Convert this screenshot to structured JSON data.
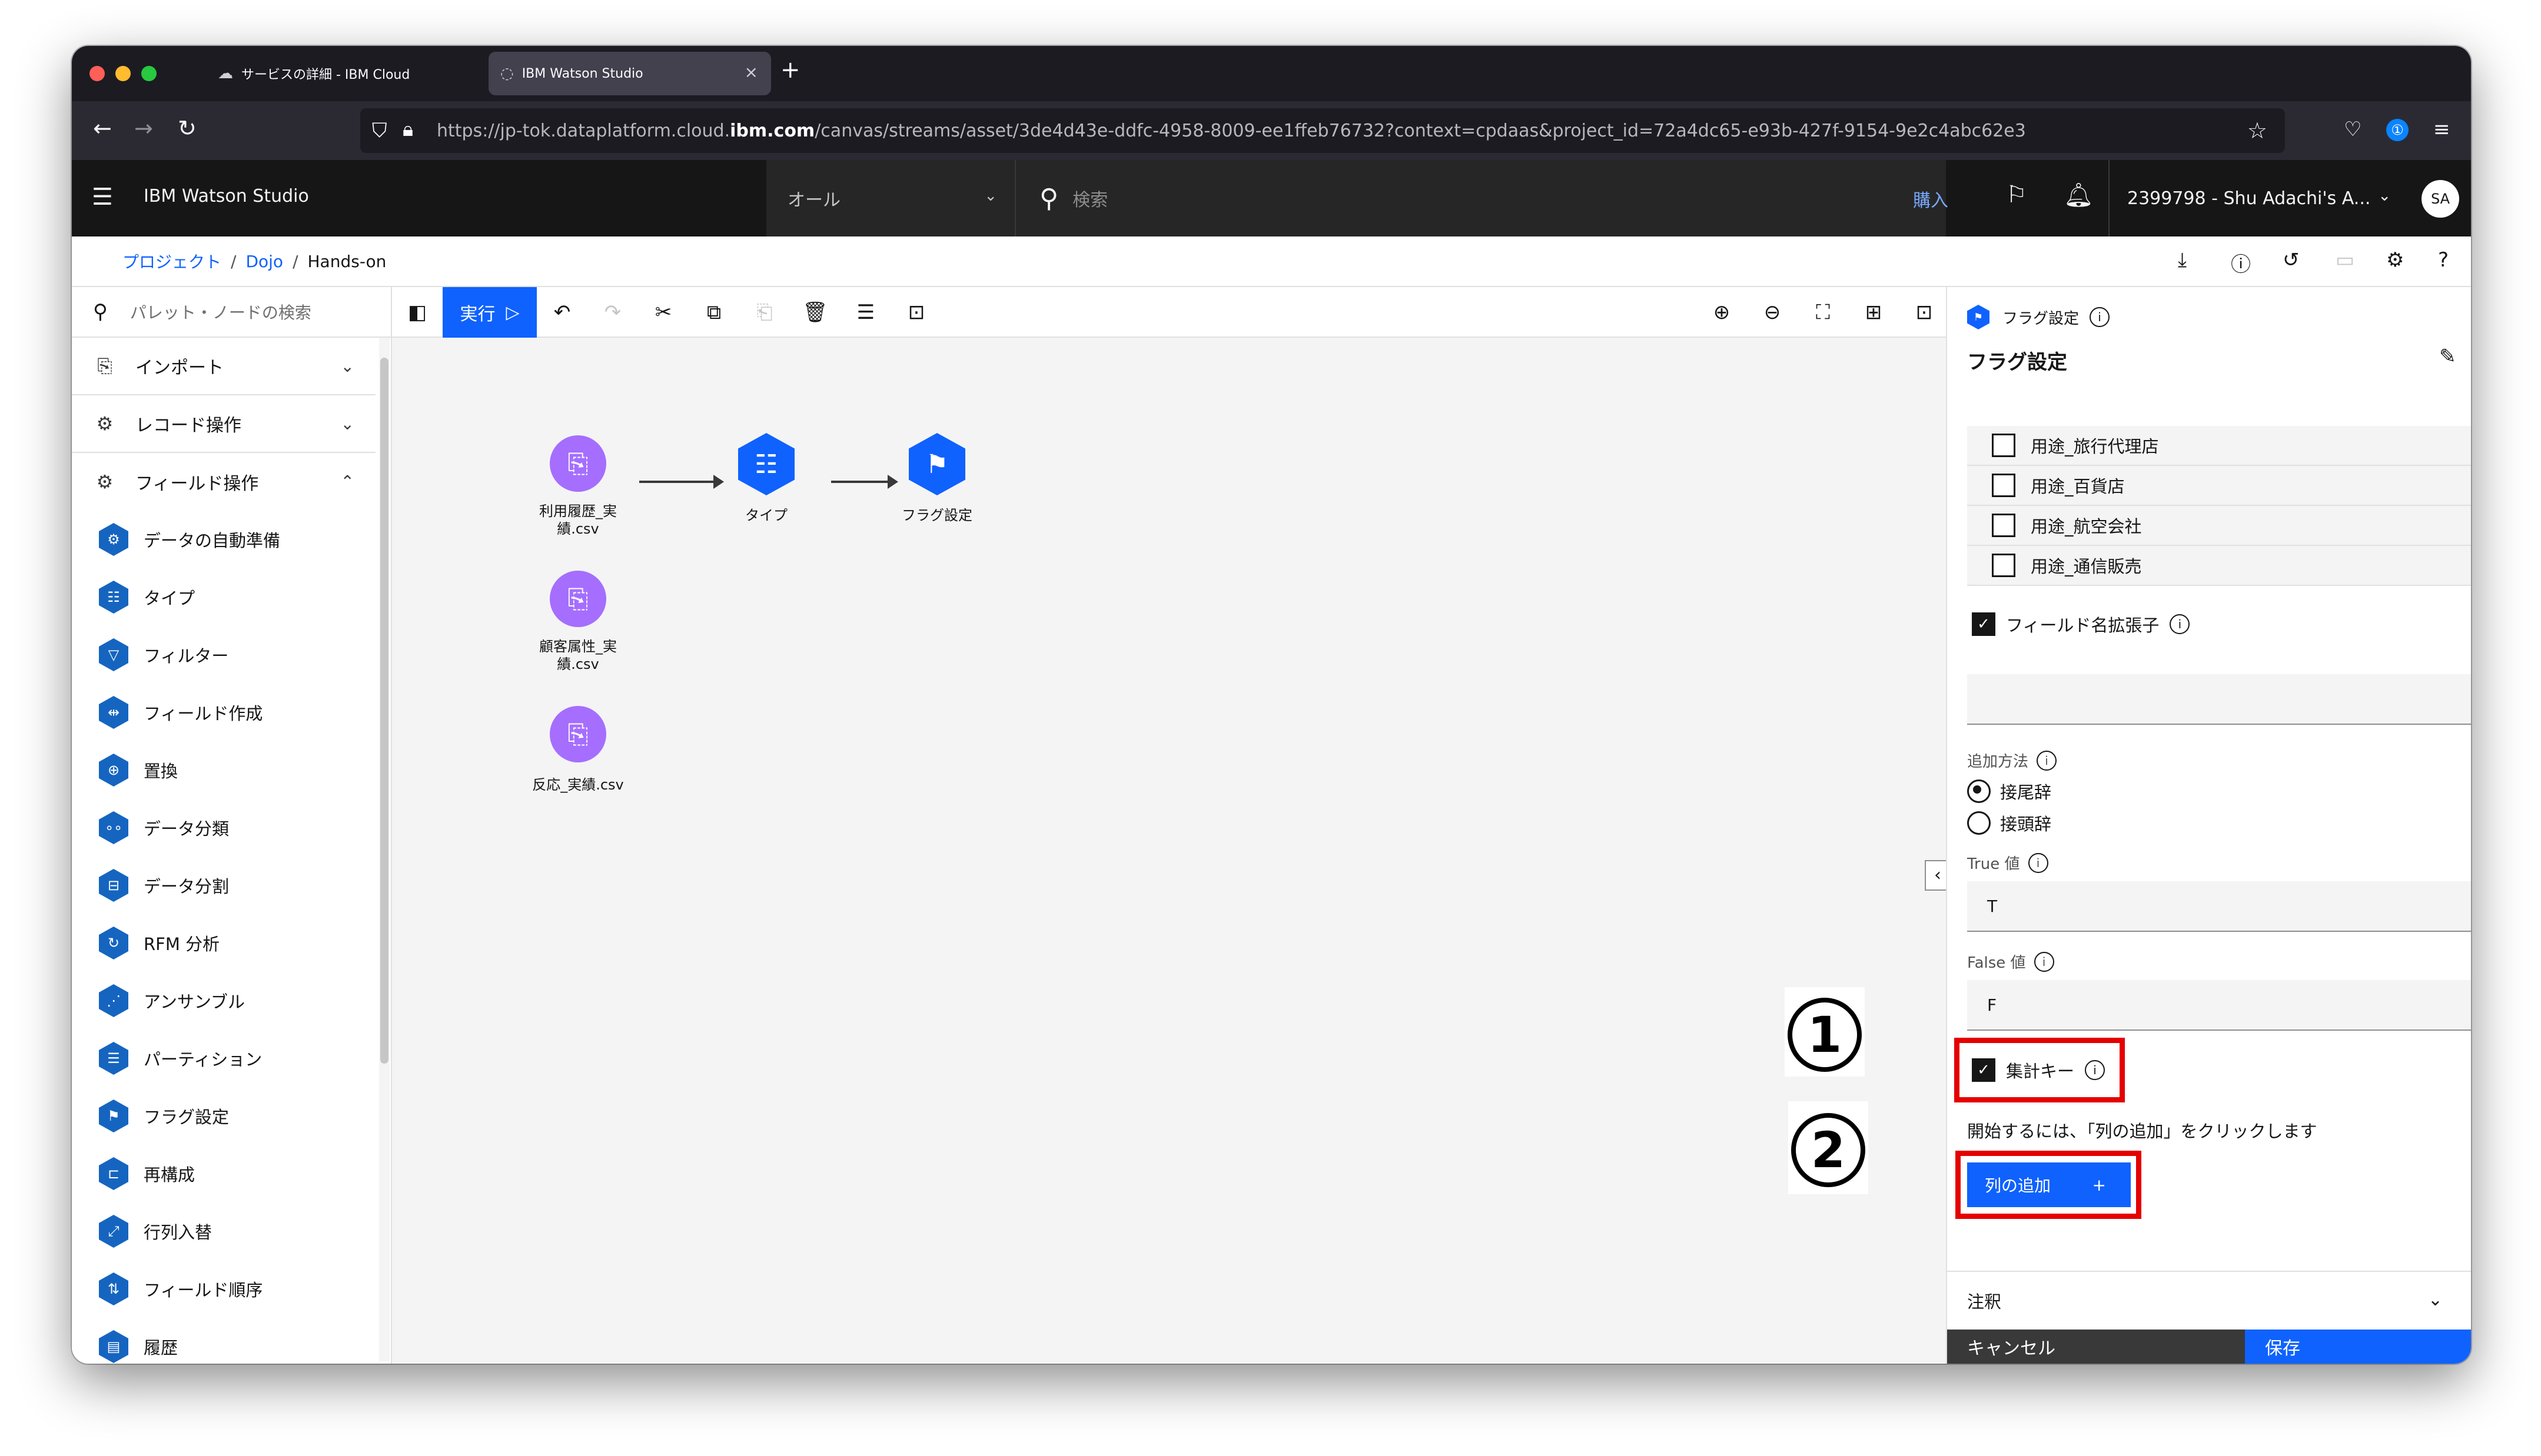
{
  "browser": {
    "tabs": [
      {
        "title": "サービスの詳細 - IBM Cloud",
        "icon": "cloud-icon",
        "active": false
      },
      {
        "title": "IBM Watson Studio",
        "icon": "loading-icon",
        "active": true
      }
    ],
    "url": {
      "prefix": "https://jp-tok.dataplatform.cloud.",
      "host": "ibm.com",
      "path": "/canvas/streams/asset/3de4d43e-ddfc-4958-8009-ee1ffeb76732?context=cpdaas&project_id=72a4dc65-e93b-427f-9154-9e2c4abc62e3"
    }
  },
  "header": {
    "product": "IBM Watson Studio",
    "scope_select": "オール",
    "search_placeholder": "検索",
    "buy": "購入",
    "account": "2399798 - Shu Adachi's A...",
    "avatar": "SA"
  },
  "breadcrumb": {
    "items": [
      "プロジェクト",
      "Dojo"
    ],
    "current": "Hands-on"
  },
  "palette": {
    "search_placeholder": "パレット・ノードの検索",
    "categories": [
      {
        "label": "インポート",
        "icon": "import-icon"
      },
      {
        "label": "レコード操作",
        "icon": "record-ops-icon"
      },
      {
        "label": "フィールド操作",
        "icon": "field-ops-icon"
      }
    ],
    "nodes": [
      "データの自動準備",
      "タイプ",
      "フィルター",
      "フィールド作成",
      "置換",
      "データ分類",
      "データ分割",
      "RFM 分析",
      "アンサンブル",
      "パーティション",
      "フラグ設定",
      "再構成",
      "行列入替",
      "フィールド順序",
      "履歴"
    ]
  },
  "toolbar": {
    "run": "実行"
  },
  "canvas": {
    "nodes": [
      {
        "label": "利用履歴_実\n績.csv"
      },
      {
        "label": "タイプ"
      },
      {
        "label": "フラグ設定"
      },
      {
        "label": "顧客属性_実\n績.csv"
      },
      {
        "label": "反応_実績.csv"
      }
    ]
  },
  "props": {
    "node_type": "フラグ設定",
    "title": "フラグ設定",
    "list_items": [
      "用途_旅行代理店",
      "用途_百貨店",
      "用途_航空会社",
      "用途_通信販売"
    ],
    "field_name_extension": "フィールド名拡張子",
    "add_method_label": "追加方法",
    "radio_suffix": "接尾辞",
    "radio_prefix": "接頭辞",
    "true_label": "True 値",
    "true_value": "T",
    "false_label": "False 値",
    "false_value": "F",
    "aggregate_key": "集計キー",
    "instruction": "開始するには、「列の追加」をクリックします",
    "add_column": "列の追加",
    "add_column_plus": "+",
    "notes": "注釈",
    "cancel": "キャンセル",
    "save": "保存"
  },
  "callouts": {
    "one": "1",
    "two": "2"
  },
  "colors": {
    "ibm_blue": "#0f62fe",
    "node_purple": "#a56eff",
    "highlight_red": "#e50000"
  }
}
